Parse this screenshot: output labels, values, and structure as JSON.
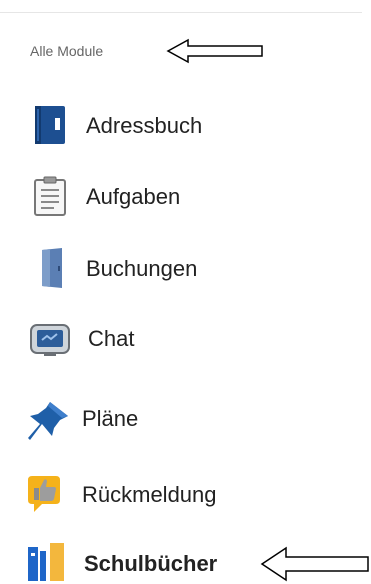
{
  "section": {
    "title": "Alle Module"
  },
  "modules": [
    {
      "label": "Adressbuch",
      "icon": "address-book-icon"
    },
    {
      "label": "Aufgaben",
      "icon": "task-list-icon"
    },
    {
      "label": "Buchungen",
      "icon": "booking-door-icon"
    },
    {
      "label": "Chat",
      "icon": "chat-monitor-icon"
    },
    {
      "label": "Pläne",
      "icon": "pushpin-icon"
    },
    {
      "label": "Rückmeldung",
      "icon": "thumbs-up-feedback-icon"
    },
    {
      "label": "Schulbücher",
      "icon": "school-books-icon",
      "active": true
    }
  ],
  "annotations": {
    "arrow_color": "#000000"
  },
  "colors": {
    "adressbuch_blue": "#1d4f91",
    "pin_blue": "#1f5fa8",
    "feedback_yellow": "#f5b21a",
    "books_blue": "#1f66c8",
    "books_yellow": "#f3b73d"
  }
}
